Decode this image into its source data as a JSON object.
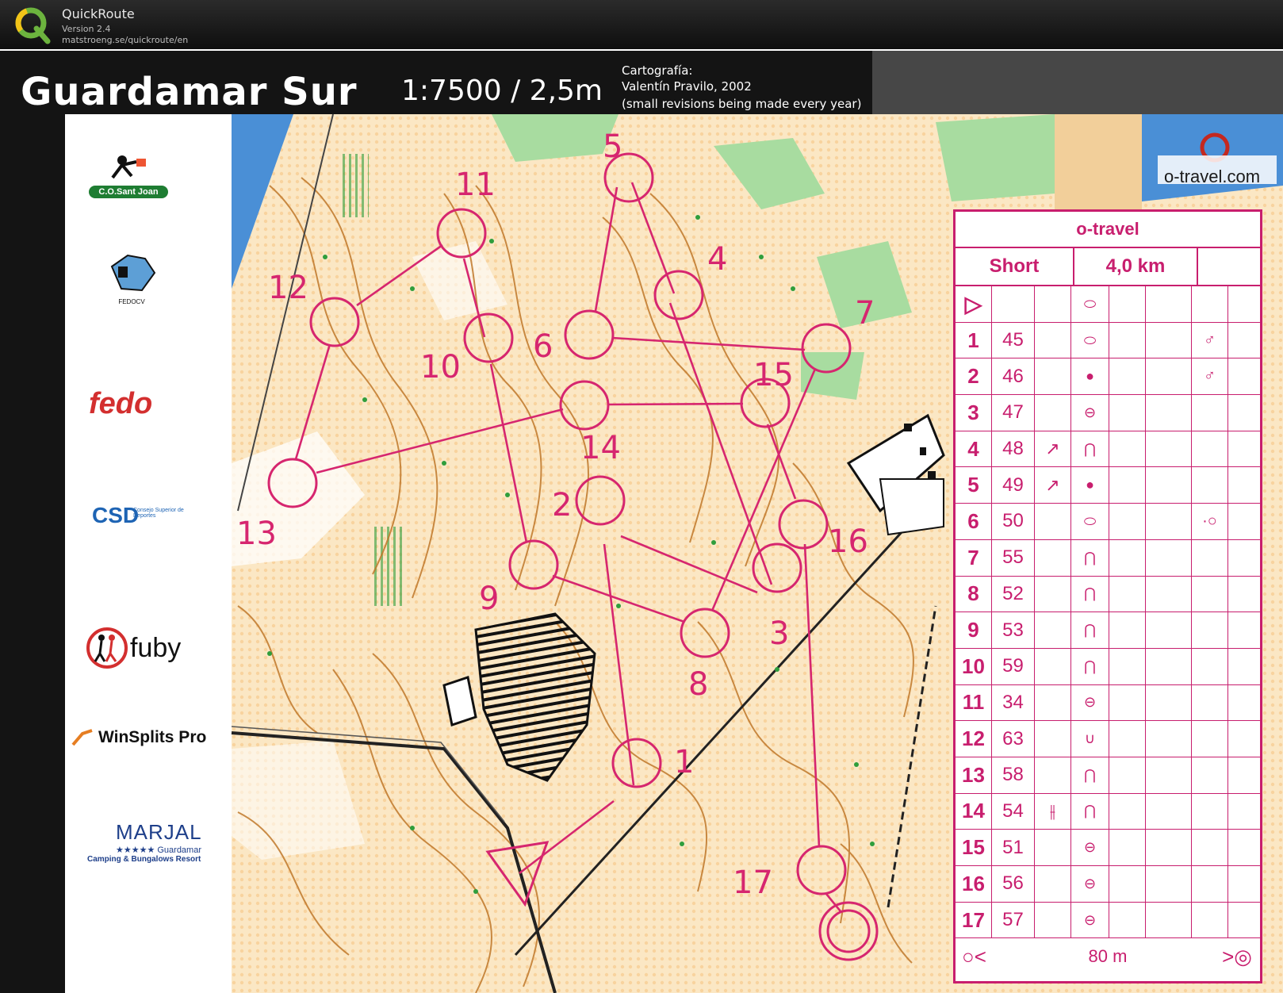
{
  "app": {
    "name": "QuickRoute",
    "version": "Version 2.4",
    "url": "matstroeng.se/quickroute/en"
  },
  "map": {
    "title": "Guardamar Sur",
    "scale": "1:7500 / 2,5m",
    "cartography_label": "Cartografía:",
    "cartography_author": "Valentín Pravilo, 2002",
    "cartography_note": "(small revisions being made every year)",
    "course_color": "#d6266f",
    "control_labels": [
      "1",
      "2",
      "3",
      "4",
      "5",
      "6",
      "7",
      "8",
      "9",
      "10",
      "11",
      "12",
      "13",
      "14",
      "15",
      "16",
      "17"
    ]
  },
  "sponsors": {
    "csj": "C.O.Sant Joan",
    "fedocv": "FEDOCV",
    "fedo": "fedo",
    "csd": "CSD",
    "csd_sub": "Consejo Superior de Deportes",
    "fuby": "fuby",
    "winsplits": "WinSplits Pro",
    "marjal": "MARJAL",
    "marjal_sub": "★★★★★ Guardamar",
    "marjal_resort": "Camping & Bungalows Resort",
    "otravel_site": "o-travel.com"
  },
  "description": {
    "event": "o-travel",
    "class": "Short",
    "length": "4,0 km",
    "start_symbol": "▷",
    "rows": [
      {
        "num": "1",
        "code": "45",
        "dir": "",
        "feat": "⬭",
        "app": "♂"
      },
      {
        "num": "2",
        "code": "46",
        "dir": "",
        "feat": "●",
        "app": "♂"
      },
      {
        "num": "3",
        "code": "47",
        "dir": "",
        "feat": "⊖",
        "app": ""
      },
      {
        "num": "4",
        "code": "48",
        "dir": "↗",
        "feat": "⋂",
        "app": ""
      },
      {
        "num": "5",
        "code": "49",
        "dir": "↗",
        "feat": "●",
        "app": ""
      },
      {
        "num": "6",
        "code": "50",
        "dir": "",
        "feat": "⬭",
        "app": "·○"
      },
      {
        "num": "7",
        "code": "55",
        "dir": "",
        "feat": "⋂",
        "app": ""
      },
      {
        "num": "8",
        "code": "52",
        "dir": "",
        "feat": "⋂",
        "app": ""
      },
      {
        "num": "9",
        "code": "53",
        "dir": "",
        "feat": "⋂",
        "app": ""
      },
      {
        "num": "10",
        "code": "59",
        "dir": "",
        "feat": "⋂",
        "app": ""
      },
      {
        "num": "11",
        "code": "34",
        "dir": "",
        "feat": "⊖",
        "app": ""
      },
      {
        "num": "12",
        "code": "63",
        "dir": "",
        "feat": "∪",
        "app": ""
      },
      {
        "num": "13",
        "code": "58",
        "dir": "",
        "feat": "⋂",
        "app": ""
      },
      {
        "num": "14",
        "code": "54",
        "dir": "⫲",
        "feat": "⋂",
        "app": ""
      },
      {
        "num": "15",
        "code": "51",
        "dir": "",
        "feat": "⊖",
        "app": ""
      },
      {
        "num": "16",
        "code": "56",
        "dir": "",
        "feat": "⊖",
        "app": ""
      },
      {
        "num": "17",
        "code": "57",
        "dir": "",
        "feat": "⊖",
        "app": ""
      }
    ],
    "finish_distance": "80 m"
  }
}
